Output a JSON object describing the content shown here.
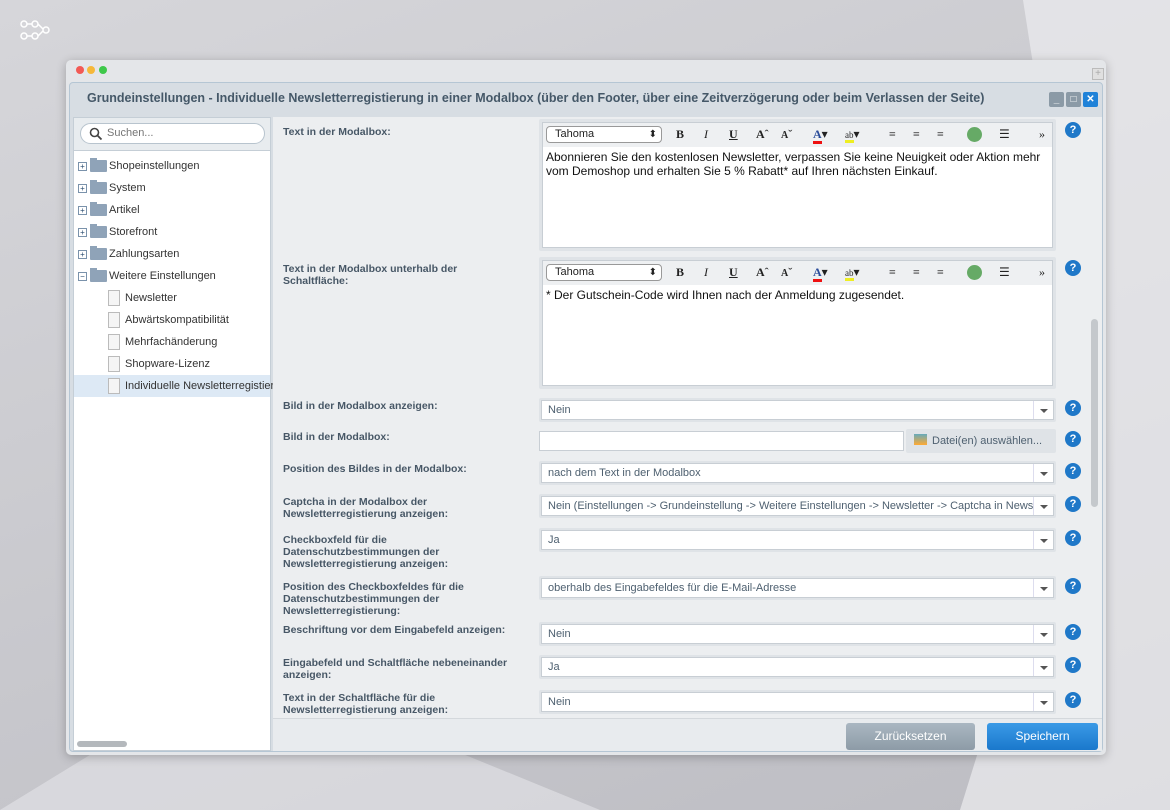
{
  "window": {
    "title": "Grundeinstellungen - Individuelle Newsletterregistierung in einer Modalbox (über den Footer, über eine Zeitverzögerung oder beim Verlassen der Seite)"
  },
  "search": {
    "placeholder": "Suchen..."
  },
  "tree": [
    {
      "label": "Shopeinstellungen",
      "type": "folder",
      "expanded": false
    },
    {
      "label": "System",
      "type": "folder",
      "expanded": false
    },
    {
      "label": "Artikel",
      "type": "folder",
      "expanded": false
    },
    {
      "label": "Storefront",
      "type": "folder",
      "expanded": false
    },
    {
      "label": "Zahlungsarten",
      "type": "folder",
      "expanded": false
    },
    {
      "label": "Weitere Einstellungen",
      "type": "folder",
      "expanded": true
    },
    {
      "label": "Newsletter",
      "type": "leaf"
    },
    {
      "label": "Abwärtskompatibilität",
      "type": "leaf"
    },
    {
      "label": "Mehrfachänderung",
      "type": "leaf"
    },
    {
      "label": "Shopware-Lizenz",
      "type": "leaf"
    },
    {
      "label": "Individuelle Newsletterregistierung",
      "type": "leaf",
      "selected": true
    }
  ],
  "editor": {
    "font": "Tahoma"
  },
  "fields": {
    "text_modal": {
      "label": "Text in der Modalbox:",
      "value": "Abonnieren Sie den kostenlosen Newsletter, verpassen Sie keine Neuigkeit oder Aktion mehr vom Demoshop und erhalten Sie 5 % Rabatt* auf Ihren nächsten Einkauf."
    },
    "text_below": {
      "label": "Text in der Modalbox unterhalb der Schaltfläche:",
      "value": "* Der Gutschein-Code wird Ihnen nach der Anmeldung zugesendet."
    },
    "selects": [
      {
        "label": "Bild in der Modalbox anzeigen:",
        "value": "Nein"
      },
      {
        "label": "Bild in der Modalbox:",
        "value": "",
        "button": "Datei(en) auswählen..."
      },
      {
        "label": "Position des Bildes in der Modalbox:",
        "value": "nach dem Text in der Modalbox"
      },
      {
        "label": "Captcha in der Modalbox der Newsletterregistierung anzeigen:",
        "value": "Nein (Einstellungen -> Grundeinstellung -> Weitere Einstellungen -> Newsletter -> Captcha in Newsletter"
      },
      {
        "label": "Checkboxfeld für die Datenschutzbestimmungen der Newsletterregistierung anzeigen:",
        "value": "Ja"
      },
      {
        "label": "Position des Checkboxfeldes für die Datenschutzbestimmungen der Newsletterregistierung:",
        "value": "oberhalb des Eingabefeldes für die E-Mail-Adresse"
      },
      {
        "label": "Beschriftung vor dem Eingabefeld anzeigen:",
        "value": "Nein"
      },
      {
        "label": "Eingabefeld und Schaltfläche nebeneinander anzeigen:",
        "value": "Ja"
      },
      {
        "label": "Text in der Schaltfläche für die Newsletterregistierung anzeigen:",
        "value": "Nein"
      }
    ]
  },
  "footer": {
    "reset": "Zurücksetzen",
    "save": "Speichern"
  },
  "colors": {
    "accent": "#1f78c8",
    "selected_row": "#dde9f5"
  }
}
